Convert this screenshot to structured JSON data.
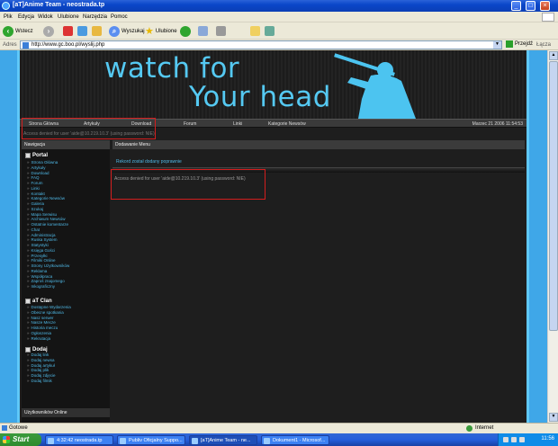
{
  "window": {
    "title": "[aT]Anime Team - neostrada.tp"
  },
  "menubar": {
    "items": [
      "Plik",
      "Edycja",
      "Widok",
      "Ulubione",
      "Narzędzia",
      "Pomoc"
    ]
  },
  "toolbar": {
    "back": "Wstecz",
    "search": "Wyszukaj",
    "favorites": "Ulubione"
  },
  "address": {
    "label": "Adres",
    "url": "http://www.gc.boo.pl/wyslij.php",
    "go": "Przejdź",
    "links": "Łącza"
  },
  "site": {
    "banner_line1": "watch for",
    "banner_line2": "Your head",
    "nav": [
      "Strona Główna",
      "Artykuły",
      "Download",
      "Forum",
      "Linki",
      "Kategorie Newsów"
    ],
    "date": "Marzec 21 2006 11:54:53",
    "top_error": "Access denied for user 'aide@10.219.10.3' (using password: NIE)",
    "sidebar_title": "Nawigacja",
    "sections": [
      {
        "title": "Portal",
        "items": [
          "Strona Główna",
          "Artykuły",
          "Download",
          "FAQ",
          "Forum",
          "Linki",
          "Kontakt",
          "Kategorie Newsów",
          "Galeria",
          "Szukaj",
          "Mapa Serwisu",
          "Archiwum Newsów",
          "Ostatnie komentarze",
          "Chat",
          "Administracja",
          "Ruska System",
          "Statystyki",
          "Księga Gości",
          "Przesyłki",
          "Filmiki Online",
          "Strony Użytkowników",
          "Reklama",
          "Współpraca",
          "Zaproś znajomego",
          "Inkograficzny"
        ]
      },
      {
        "title": "aT Clan",
        "items": [
          "Dostępne Wydarzenia",
          "Obecne spotkania",
          "Nasz serwer",
          "Nasze Mecze",
          "Historia meczu",
          "Ogłoszenia",
          "Rekrutacja"
        ]
      },
      {
        "title": "Dodaj",
        "items": [
          "Dodaj link",
          "Dodaj newsa",
          "Dodaj artykuł",
          "Dodaj plik",
          "Dodaj zdjęcie",
          "Dodaj filmik"
        ]
      }
    ],
    "online_title": "Użytkowników Online",
    "main_title": "Dodawanie Menu",
    "success_msg": "Rekord został dodany poprawnie",
    "error_msg": "Access denied for user 'aide@10.219.10.3' (using password: NIE)"
  },
  "statusbar": {
    "status": "Gotowe",
    "zone": "Internet"
  },
  "taskbar": {
    "start": "Start",
    "tasks": [
      "4:32:42 neostrada.tp",
      "Publiv Oficjalny Suppo...",
      "[aT]Anime Team - ne...",
      "Dokument1 - Microsof..."
    ],
    "clock": "11:56"
  }
}
